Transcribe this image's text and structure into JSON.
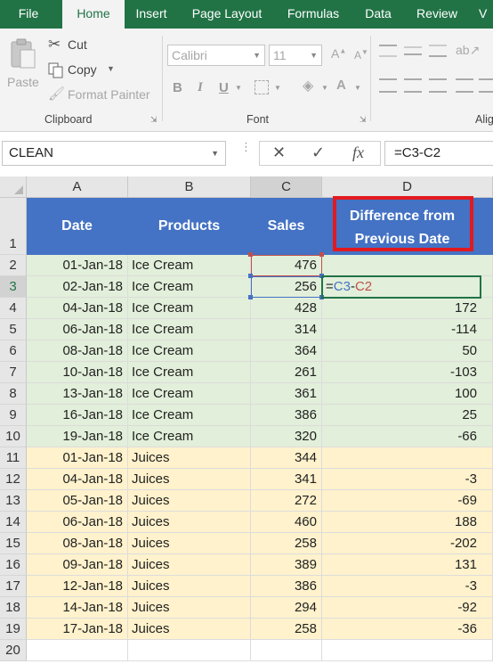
{
  "ribbon_tabs": [
    {
      "label": "File",
      "active": false
    },
    {
      "label": "Home",
      "active": true
    },
    {
      "label": "Insert",
      "active": false
    },
    {
      "label": "Page Layout",
      "active": false
    },
    {
      "label": "Formulas",
      "active": false
    },
    {
      "label": "Data",
      "active": false
    },
    {
      "label": "Review",
      "active": false
    },
    {
      "label": "V",
      "active": false
    }
  ],
  "clipboard": {
    "paste_label": "Paste",
    "cut_label": "Cut",
    "copy_label": "Copy",
    "format_painter_label": "Format Painter",
    "group_label": "Clipboard"
  },
  "font": {
    "font_name": "Calibri",
    "font_size": "11",
    "bold_label": "B",
    "italic_label": "I",
    "underline_label": "U",
    "group_label": "Font"
  },
  "alignment": {
    "group_label_partial": "Alig"
  },
  "formula_bar": {
    "name_box": "CLEAN",
    "cancel_symbol": "✕",
    "enter_symbol": "✓",
    "fx_symbol": "fx",
    "formula": "=C3-C2"
  },
  "columns": [
    "A",
    "B",
    "C",
    "D"
  ],
  "header_row": {
    "row_number": "1",
    "date": "Date",
    "products": "Products",
    "sales": "Sales",
    "difference_line1": "Difference from",
    "difference_line2": "Previous Date"
  },
  "rows": [
    {
      "n": "2",
      "date": "01-Jan-18",
      "product": "Ice Cream",
      "sales": "476",
      "diff": ""
    },
    {
      "n": "3",
      "date": "02-Jan-18",
      "product": "Ice Cream",
      "sales": "256",
      "diff": ""
    },
    {
      "n": "4",
      "date": "04-Jan-18",
      "product": "Ice Cream",
      "sales": "428",
      "diff": "172"
    },
    {
      "n": "5",
      "date": "06-Jan-18",
      "product": "Ice Cream",
      "sales": "314",
      "diff": "-114"
    },
    {
      "n": "6",
      "date": "08-Jan-18",
      "product": "Ice Cream",
      "sales": "364",
      "diff": "50"
    },
    {
      "n": "7",
      "date": "10-Jan-18",
      "product": "Ice Cream",
      "sales": "261",
      "diff": "-103"
    },
    {
      "n": "8",
      "date": "13-Jan-18",
      "product": "Ice Cream",
      "sales": "361",
      "diff": "100"
    },
    {
      "n": "9",
      "date": "16-Jan-18",
      "product": "Ice Cream",
      "sales": "386",
      "diff": "25"
    },
    {
      "n": "10",
      "date": "19-Jan-18",
      "product": "Ice Cream",
      "sales": "320",
      "diff": "-66"
    },
    {
      "n": "11",
      "date": "01-Jan-18",
      "product": "Juices",
      "sales": "344",
      "diff": ""
    },
    {
      "n": "12",
      "date": "04-Jan-18",
      "product": "Juices",
      "sales": "341",
      "diff": "-3"
    },
    {
      "n": "13",
      "date": "05-Jan-18",
      "product": "Juices",
      "sales": "272",
      "diff": "-69"
    },
    {
      "n": "14",
      "date": "06-Jan-18",
      "product": "Juices",
      "sales": "460",
      "diff": "188"
    },
    {
      "n": "15",
      "date": "08-Jan-18",
      "product": "Juices",
      "sales": "258",
      "diff": "-202"
    },
    {
      "n": "16",
      "date": "09-Jan-18",
      "product": "Juices",
      "sales": "389",
      "diff": "131"
    },
    {
      "n": "17",
      "date": "12-Jan-18",
      "product": "Juices",
      "sales": "386",
      "diff": "-3"
    },
    {
      "n": "18",
      "date": "14-Jan-18",
      "product": "Juices",
      "sales": "294",
      "diff": "-92"
    },
    {
      "n": "19",
      "date": "17-Jan-18",
      "product": "Juices",
      "sales": "258",
      "diff": "-36"
    },
    {
      "n": "20",
      "date": "",
      "product": "",
      "sales": "",
      "diff": ""
    }
  ],
  "editing_cell": {
    "row": "3",
    "prefix": "=",
    "ref1": "C3",
    "operator": "-",
    "ref2": "C2"
  },
  "colors": {
    "excel_green": "#217346",
    "header_fill": "#4472c4",
    "ice_cream_fill": "#e2efda",
    "juices_fill": "#fff2cc",
    "highlight_border": "#e2191f",
    "ref_blue": "#4472c4",
    "ref_red": "#c0504d"
  },
  "icons": [
    "scissors-icon",
    "copy-icon",
    "paintbrush-icon",
    "clipboard-icon",
    "cancel-icon",
    "enter-icon",
    "function-icon",
    "select-all-icon"
  ]
}
